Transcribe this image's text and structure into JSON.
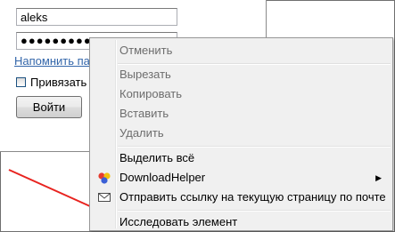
{
  "login": {
    "username_value": "aleks",
    "password_value": "●●●●●●●●●",
    "remind_link": "Напомнить па",
    "remember_label": "Привязать",
    "login_button": "Войти"
  },
  "context_menu": {
    "items": [
      {
        "label": "Отменить",
        "enabled": false
      },
      {
        "label": "Вырезать",
        "enabled": false
      },
      {
        "label": "Копировать",
        "enabled": false
      },
      {
        "label": "Вставить",
        "enabled": false
      },
      {
        "label": "Удалить",
        "enabled": false
      },
      {
        "label": "Выделить всё",
        "enabled": true
      },
      {
        "label": "DownloadHelper",
        "enabled": true,
        "icon": "downloadhelper-icon",
        "submenu": true
      },
      {
        "label": "Отправить ссылку на текущую страницу по почте",
        "enabled": true,
        "icon": "envelope-icon"
      },
      {
        "label": "Исследовать элемент",
        "enabled": true
      }
    ],
    "submenu_arrow": "▶"
  },
  "colors": {
    "annotation_arrow": "#e8231f",
    "link": "#3366aa",
    "menu_background": "#f0f0f0",
    "disabled_text": "#6d6d6d"
  }
}
